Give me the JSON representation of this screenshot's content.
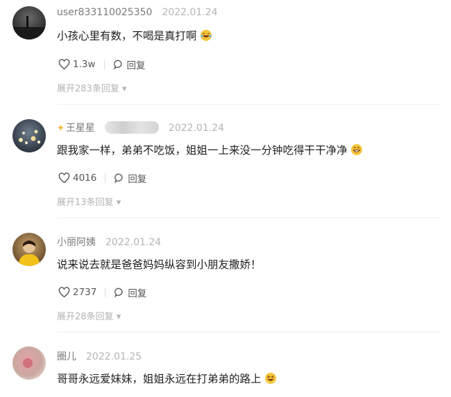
{
  "comments": [
    {
      "username": "user833110025350",
      "date": "2022.01.24",
      "text": "小孩心里有数，不喝是真打啊",
      "likes": "1.3w",
      "reply_label": "回复",
      "expand": "展开283条回复",
      "avatar_icon": "avatar-dark-landscape",
      "emoji_icon": "laughing-tears-emoji"
    },
    {
      "username": "王星星",
      "username_prefix_icon": "sparkle-star-icon",
      "date": "2022.01.24",
      "text": "跟我家一样，弟弟不吃饭，姐姐一上来没一分钟吃得干干净净",
      "likes": "4016",
      "reply_label": "回复",
      "expand": "展开13条回复",
      "avatar_icon": "avatar-night-lights",
      "emoji_icon": "grinning-emoji"
    },
    {
      "username": "小丽阿姨",
      "date": "2022.01.24",
      "text": "说来说去就是爸爸妈妈纵容到小朋友撒娇！",
      "likes": "2737",
      "reply_label": "回复",
      "expand": "展开28条回复",
      "avatar_icon": "avatar-person-yellow"
    },
    {
      "username": "圈儿",
      "date": "2022.01.25",
      "text": "哥哥永远爱妹妹，姐姐永远在打弟弟的路上",
      "avatar_icon": "avatar-pink-blur",
      "emoji_icon": "squinting-grin-emoji"
    }
  ],
  "colors": {
    "username": "#7a7a7a",
    "date": "#b4b4b4",
    "expand": "#b3b3b3",
    "emoji": "#f5c53a"
  }
}
